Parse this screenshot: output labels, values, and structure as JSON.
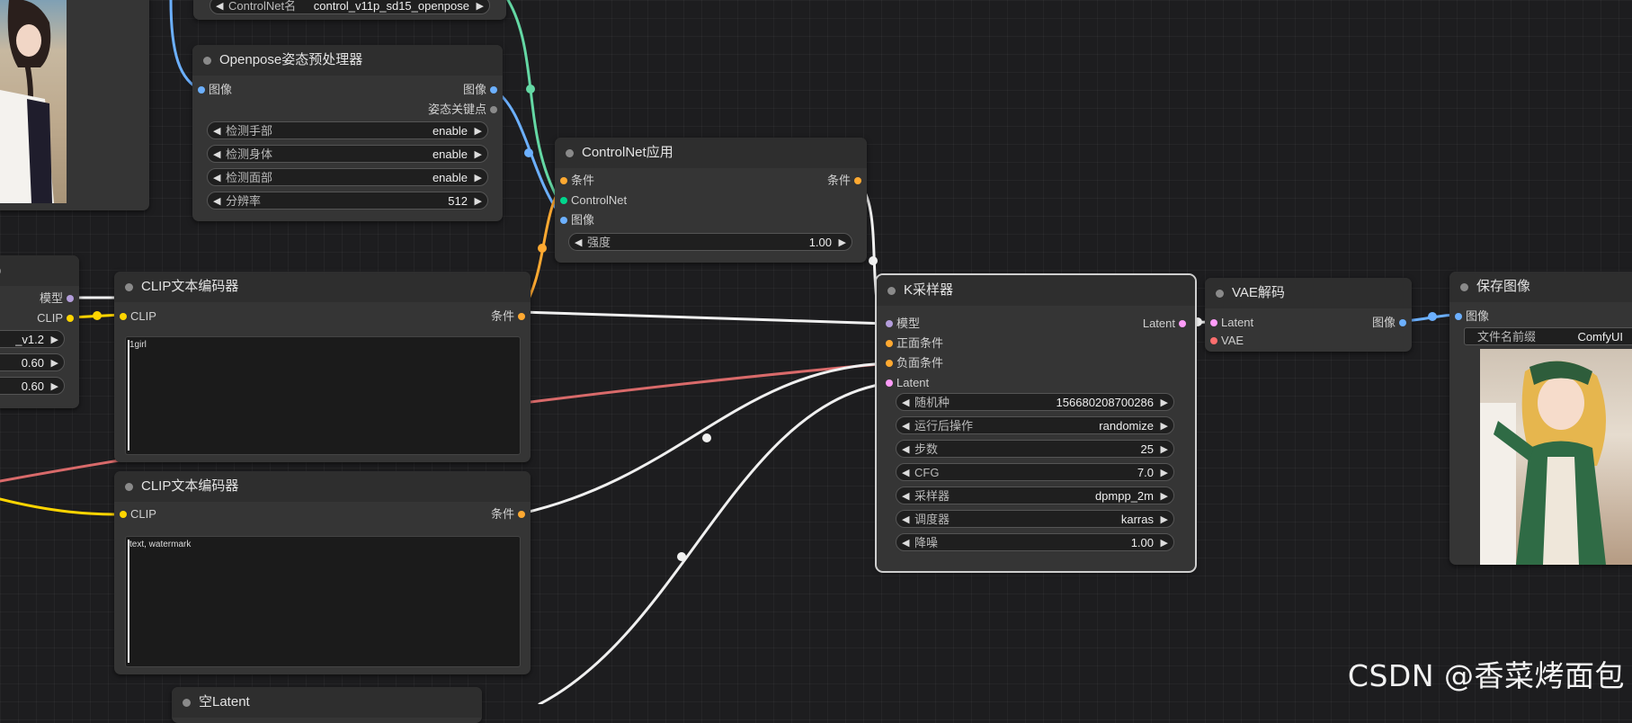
{
  "colors": {
    "background": "#1d1d1f",
    "node": "#353535",
    "image_slot": "#6cb0ff",
    "conditioning_slot": "#ffa931",
    "clip_slot": "#ffd500",
    "model_slot": "#b39ddb",
    "latent_slot": "#ff9cf9",
    "vae_slot": "#ff6e6e",
    "controlnet_slot": "#00d78d"
  },
  "top_partial_node": {
    "label_fragment": "ControlNet名",
    "value_fragment": "control_v11p_sd15_openpose"
  },
  "openpose_node": {
    "title": "Openpose姿态预处理器",
    "in_image": "图像",
    "out_image": "图像",
    "out_keypoints": "姿态关键点",
    "widgets": [
      {
        "label": "检测手部",
        "value": "enable"
      },
      {
        "label": "检测身体",
        "value": "enable"
      },
      {
        "label": "检测面部",
        "value": "enable"
      },
      {
        "label": "分辨率",
        "value": "512"
      }
    ]
  },
  "controlnet_apply_node": {
    "title": "ControlNet应用",
    "in_cond": "条件",
    "in_controlnet": "ControlNet",
    "in_image": "图像",
    "out_cond": "条件",
    "strength_label": "强度",
    "strength_value": "1.00"
  },
  "left_partial_node": {
    "out_model": "模型",
    "out_clip": "CLIP",
    "widget_values": [
      "_v1.2",
      "0.60",
      "0.60"
    ]
  },
  "clip_encoder_positive": {
    "title": "CLIP文本编码器",
    "in_clip": "CLIP",
    "out_cond": "条件",
    "text": "1girl"
  },
  "clip_encoder_negative": {
    "title": "CLIP文本编码器",
    "in_clip": "CLIP",
    "out_cond": "条件",
    "text": "text, watermark"
  },
  "empty_latent_node": {
    "title": "空Latent"
  },
  "ksampler_node": {
    "title": "K采样器",
    "in_model": "模型",
    "in_positive": "正面条件",
    "in_negative": "负面条件",
    "in_latent": "Latent",
    "out_latent": "Latent",
    "widgets": [
      {
        "label": "随机种",
        "value": "156680208700286"
      },
      {
        "label": "运行后操作",
        "value": "randomize"
      },
      {
        "label": "步数",
        "value": "25"
      },
      {
        "label": "CFG",
        "value": "7.0"
      },
      {
        "label": "采样器",
        "value": "dpmpp_2m"
      },
      {
        "label": "调度器",
        "value": "karras"
      },
      {
        "label": "降噪",
        "value": "1.00"
      }
    ]
  },
  "vae_decode_node": {
    "title": "VAE解码",
    "in_latent": "Latent",
    "in_vae": "VAE",
    "out_image": "图像"
  },
  "save_image_node": {
    "title": "保存图像",
    "in_image": "图像",
    "prefix_label": "文件名前缀",
    "prefix_value": "ComfyUI"
  },
  "watermark": "CSDN @香菜烤面包"
}
